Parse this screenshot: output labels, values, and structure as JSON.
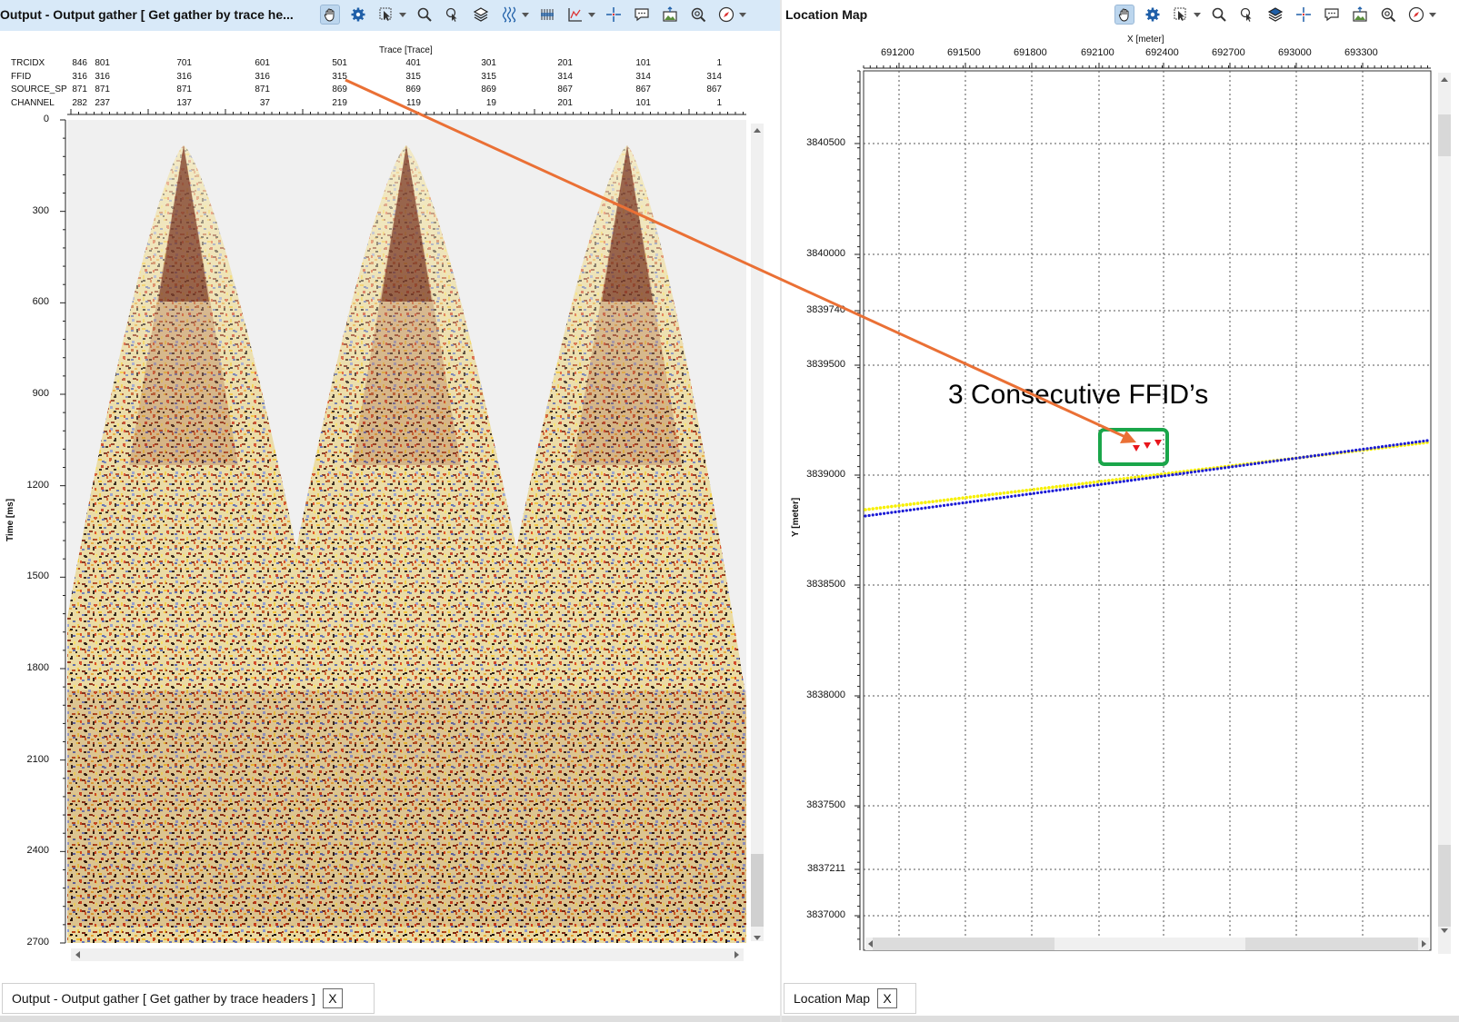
{
  "left": {
    "title": "Output - Output gather [ Get gather by trace he...",
    "trace_axis_title": "Trace [Trace]",
    "time_axis_title": "Time [ms]",
    "header_rows": [
      {
        "label": "TRCIDX",
        "values": [
          "846",
          "801",
          "701",
          "601",
          "501",
          "401",
          "301",
          "201",
          "101",
          "1"
        ]
      },
      {
        "label": "FFID",
        "values": [
          "316",
          "316",
          "316",
          "316",
          "315",
          "315",
          "315",
          "314",
          "314",
          "314"
        ]
      },
      {
        "label": "SOURCE_SP",
        "values": [
          "871",
          "871",
          "871",
          "871",
          "869",
          "869",
          "869",
          "867",
          "867",
          "867"
        ]
      },
      {
        "label": "CHANNEL",
        "values": [
          "282",
          "237",
          "137",
          "37",
          "219",
          "119",
          "19",
          "201",
          "101",
          "1"
        ]
      }
    ],
    "time_ticks": [
      "0",
      "300",
      "600",
      "900",
      "1200",
      "1500",
      "1800",
      "2100",
      "2400",
      "2700"
    ],
    "tab_label": "Output - Output gather [ Get gather by trace headers ]",
    "close_label": "X"
  },
  "right": {
    "title": "Location Map",
    "x_axis_title": "X [meter]",
    "y_axis_title": "Y [meter]",
    "x_ticks": [
      "691200",
      "691500",
      "691800",
      "692100",
      "692400",
      "692700",
      "693000",
      "693300"
    ],
    "y_ticks": [
      "3840500",
      "3840000",
      "3839740",
      "3839500",
      "3839000",
      "3838500",
      "3838000",
      "3837500",
      "3837211",
      "3837000"
    ],
    "annotation": "3 Consecutive FFID’s",
    "tab_label": "Location Map",
    "close_label": "X"
  },
  "toolbar_icons": [
    "pan-hand",
    "settings-gear",
    "select-cursor",
    "zoom-magnifier",
    "pick-tool",
    "layers",
    "wiggle",
    "header-display",
    "spectrum",
    "crosshair",
    "comment",
    "export",
    "zoom-fit",
    "compass"
  ],
  "colors": {
    "title_bar": "#d8e9f8",
    "arrow": "#ea7035",
    "highlight_box": "#1aa64a",
    "receiver_line": "#f7f000",
    "source_line": "#1b1bd6",
    "shot_markers": "#e8151b"
  }
}
